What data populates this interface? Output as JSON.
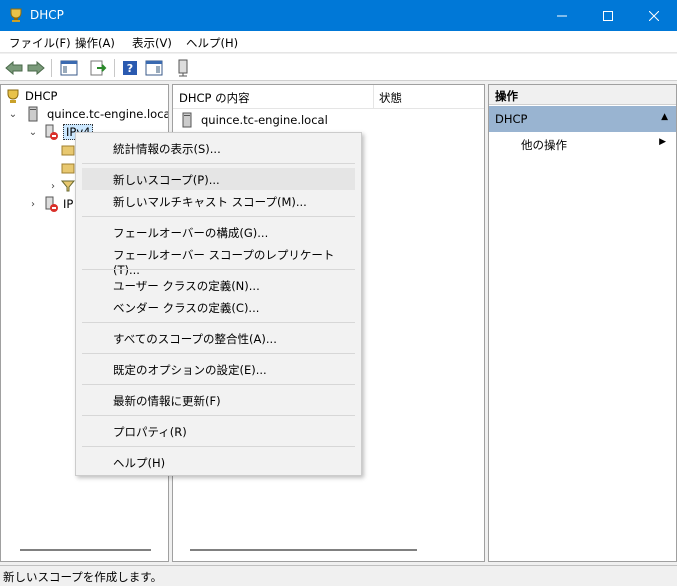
{
  "window": {
    "title": "DHCP",
    "accent_color": "#0078d7"
  },
  "menubar": {
    "items": [
      "ファイル(F)",
      "操作(A)",
      "表示(V)",
      "ヘルプ(H)"
    ]
  },
  "toolbar": {
    "buttons": [
      "back-icon",
      "forward-icon",
      "show-hide-tree-icon",
      "export-list-icon",
      "help-icon",
      "show-action-pane-icon",
      "server-icon"
    ]
  },
  "tree": {
    "root": "DHCP",
    "server": "quince.tc-engine.local",
    "ipv4": "IPv4",
    "ipv6_partial": "IP"
  },
  "content": {
    "col_name": "DHCP の内容",
    "col_status": "状態",
    "row_name": "quince.tc-engine.local"
  },
  "actions": {
    "header": "操作",
    "group": "DHCP",
    "group_color": "#99b4d1",
    "item": "他の操作"
  },
  "context_menu": {
    "items": [
      "統計情報の表示(S)...",
      "新しいスコープ(P)...",
      "新しいマルチキャスト スコープ(M)...",
      "フェールオーバーの構成(G)...",
      "フェールオーバー スコープのレプリケート(T)...",
      "ユーザー クラスの定義(N)...",
      "ベンダー クラスの定義(C)...",
      "すべてのスコープの整合性(A)...",
      "既定のオプションの設定(E)...",
      "最新の情報に更新(F)",
      "プロパティ(R)",
      "ヘルプ(H)"
    ],
    "hovered": "新しいスコープ(P)..."
  },
  "statusbar": {
    "text": "新しいスコープを作成します。"
  }
}
